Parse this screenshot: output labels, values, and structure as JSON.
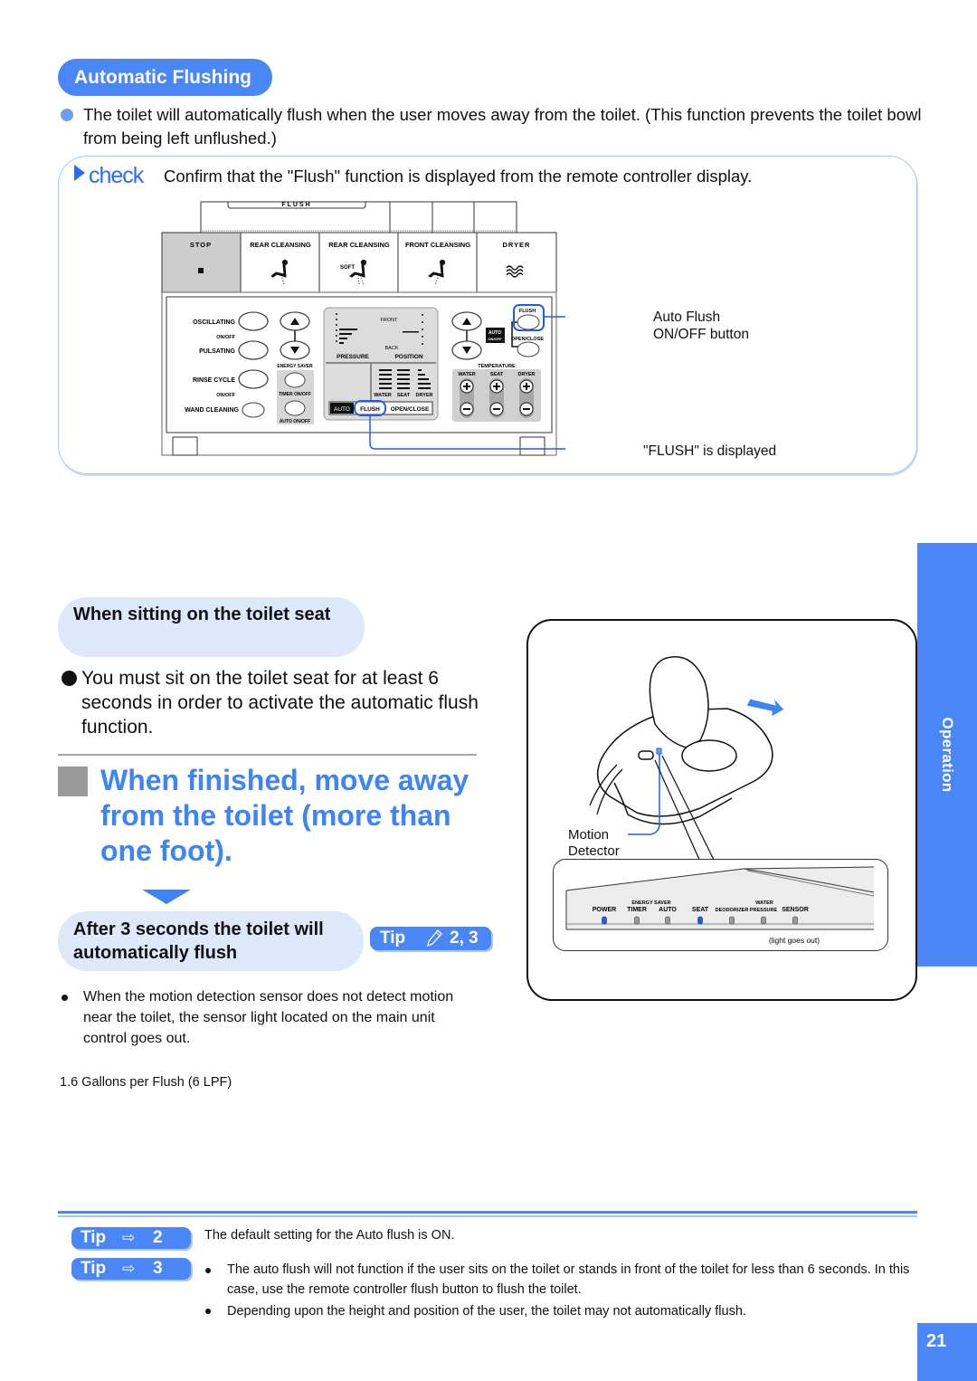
{
  "section": {
    "title": "Automatic Flushing",
    "intro": "The toilet will automatically flush when the user moves away from the toilet. (This function prevents the toilet bowl from being left unflushed.)"
  },
  "check": {
    "label": "check",
    "text": "Confirm that the \"Flush\" function is displayed from the remote controller display."
  },
  "remote": {
    "top_label": "FLUSH",
    "function_buttons": [
      {
        "label": "STOP",
        "icon": "stop-square-icon"
      },
      {
        "label": "REAR CLEANSING",
        "icon": "rear-cleansing-icon"
      },
      {
        "label": "REAR CLEANSING",
        "icon": "rear-soft-cleansing-icon",
        "sub": "SOFT"
      },
      {
        "label": "FRONT CLEANSING",
        "icon": "front-cleansing-icon"
      },
      {
        "label": "DRYER",
        "icon": "dryer-icon"
      }
    ],
    "left_controls": {
      "oscillating": "OSCILLATING",
      "onoff1": "ON/OFF",
      "pulsating": "PULSATING",
      "energy_saver": "ENERGY SAVER",
      "rinse_cycle": "RINSE CYCLE",
      "onoff2": "ON/OFF",
      "timer_onoff": "TIMER ON/OFF",
      "wand_cleaning": "WAND CLEANING",
      "auto_onoff": "AUTO ON/OFF"
    },
    "display": {
      "front": "FRONT",
      "back": "BACK",
      "pressure": "PRESSURE",
      "position": "POSITION",
      "water": "WATER",
      "seat": "SEAT",
      "dryer": "DRYER",
      "auto": "AUTO",
      "flush": "FLUSH",
      "open_close": "OPEN/CLOSE"
    },
    "right_controls": {
      "flush": "FLUSH",
      "auto_onoff": "AUTO ON/OFF",
      "open_close": "OPEN/CLOSE",
      "temperature": "TEMPERATURE",
      "water": "WATER",
      "seat": "SEAT",
      "dryer": "DRYER"
    }
  },
  "callouts": {
    "auto_flush_line1": "Auto Flush",
    "auto_flush_line2": "ON/OFF button",
    "flush_displayed": "\"FLUSH\" is displayed"
  },
  "side_tab": {
    "label": "Operation"
  },
  "sitting": {
    "heading": "When sitting on the toilet seat",
    "text": "You must sit on the toilet seat for at least 6 seconds in order to activate the automatic flush function."
  },
  "step": {
    "title": "When finished, move away from the toilet (more than one foot).",
    "result": "After 3 seconds the toilet will automatically flush",
    "tip_label": "Tip",
    "tip_refs": "2, 3"
  },
  "note": {
    "text": "When the motion detection sensor does not detect motion near the toilet, the sensor light located on the main unit control goes out."
  },
  "gallons": "1.6 Gallons per Flush (6 LPF)",
  "illustration": {
    "motion_label_1": "Motion",
    "motion_label_2": "Detector",
    "panel": {
      "energy_saver": "ENERGY SAVER",
      "water": "WATER",
      "indicators": [
        {
          "label": "POWER",
          "lit": true
        },
        {
          "label": "TIMER",
          "lit": false
        },
        {
          "label": "AUTO",
          "lit": false
        },
        {
          "label": "SEAT",
          "lit": true
        },
        {
          "label": "DEODORIZER",
          "lit": false
        },
        {
          "label": "PRESSURE",
          "lit": false
        },
        {
          "label": "SENSOR",
          "lit": false
        }
      ],
      "caption": "(light goes out)"
    }
  },
  "tips": [
    {
      "label": "Tip",
      "ref": "2",
      "text": "The default setting for the Auto flush is ON."
    },
    {
      "label": "Tip",
      "ref": "3",
      "bullets": [
        "The auto flush will not function if the user sits on the toilet or stands in front of the toilet for less than 6 seconds. In this case, use the remote controller flush button to flush the toilet.",
        "Depending upon the height and position of the user, the toilet may not automatically flush."
      ]
    }
  ],
  "page_number": "21",
  "colors": {
    "accent": "#4a86f5",
    "accent_light": "#dde8fb",
    "title_blue": "#3d84f5",
    "callout_blue": "#1f5fe8"
  }
}
